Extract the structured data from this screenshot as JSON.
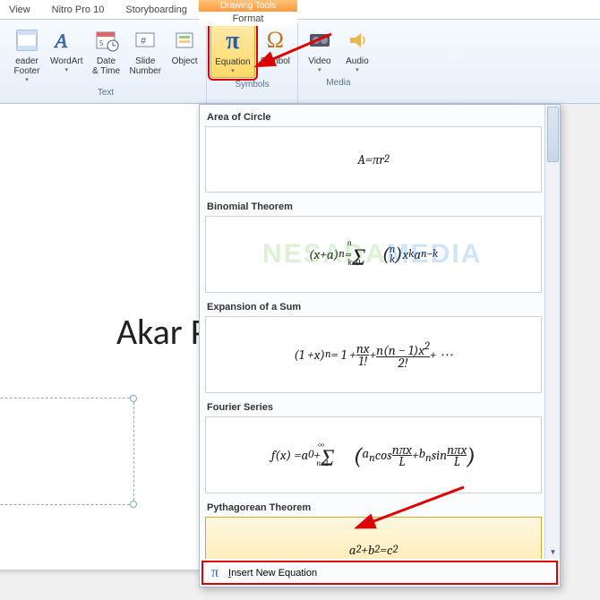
{
  "menubar": {
    "view": "View",
    "nitro": "Nitro Pro 10",
    "storyboarding": "Storyboarding"
  },
  "contextual": {
    "title": "Drawing Tools",
    "tab": "Format"
  },
  "ribbon": {
    "text_group": "Text",
    "header_footer": "eader\nFooter",
    "wordart": "WordArt",
    "date_time": "Date\n& Time",
    "slide_number": "Slide\nNumber",
    "object": "Object",
    "symbols_group": "Symbols",
    "equation": "Equation",
    "symbol": "Symbol",
    "media_group": "Media",
    "video": "Video",
    "audio": "Audio"
  },
  "slide": {
    "title_text": "Akar P"
  },
  "gallery": {
    "items": [
      {
        "title": "Area of Circle",
        "formula_html": "<i>A</i> = <i>πr</i><sup>2</sup>"
      },
      {
        "title": "Binomial Theorem",
        "formula_html": "(<i>x</i> + <i>a</i>)<sup><i>n</i></sup> = <span style='font-size:26px;position:relative;top:4px'>Σ</span><sub style='position:relative;left:-20px;top:10px;font-size:9px'><i>k</i>=0</sub><sup style='position:relative;left:-34px;top:-12px;font-size:9px'><i>n</i></sup> <span style='font-size:22px'>(</span><span style='display:inline-block;text-align:center;line-height:11px;font-size:12px'><i>n</i><br><i>k</i></span><span style='font-size:22px'>)</span> <i>x</i><sup><i>k</i></sup><i>a</i><sup><i>n−k</i></sup>"
      },
      {
        "title": "Expansion of a Sum",
        "formula_html": "(1 + <i>x</i>)<sup><i>n</i></sup> = 1 + <span style='display:inline-block;text-align:center;line-height:13px'><i>nx</i><span style='display:block;border-top:1px solid #222'>1!</span></span> + <span style='display:inline-block;text-align:center;line-height:13px'><i>n</i>(<i>n</i> − 1)<i>x</i><sup>2</sup><span style='display:block;border-top:1px solid #222'>2!</span></span> + ⋯"
      },
      {
        "title": "Fourier Series",
        "formula_html": "<i>f</i>(<i>x</i>) = <i>a</i><sub>0</sub> + <span style='font-size:26px;position:relative;top:4px'>Σ</span><sub style='position:relative;left:-20px;top:10px;font-size:9px'><i>n</i>=1</sub><sup style='position:relative;left:-32px;top:-12px;font-size:11px'>∞</sup> <span style='font-size:26px;position:relative;top:2px'>(</span><i>a<sub>n</sub></i> cos <span style='display:inline-block;text-align:center;line-height:12px'><i>nπx</i><span style='display:block;border-top:1px solid #222'><i>L</i></span></span> + <i>b<sub>n</sub></i> sin <span style='display:inline-block;text-align:center;line-height:12px'><i>nπx</i><span style='display:block;border-top:1px solid #222'><i>L</i></span></span><span style='font-size:26px;position:relative;top:2px'>)</span>"
      },
      {
        "title": "Pythagorean Theorem",
        "formula_html": "<i>a</i><sup>2</sup> + <i>b</i><sup>2</sup> = <i>c</i><sup>2</sup>",
        "selected": true
      }
    ],
    "footer_label": "Insert New Equation",
    "footer_underline_char": "I"
  },
  "watermark": {
    "part1": "NESADA",
    "part2": "MEDIA"
  }
}
